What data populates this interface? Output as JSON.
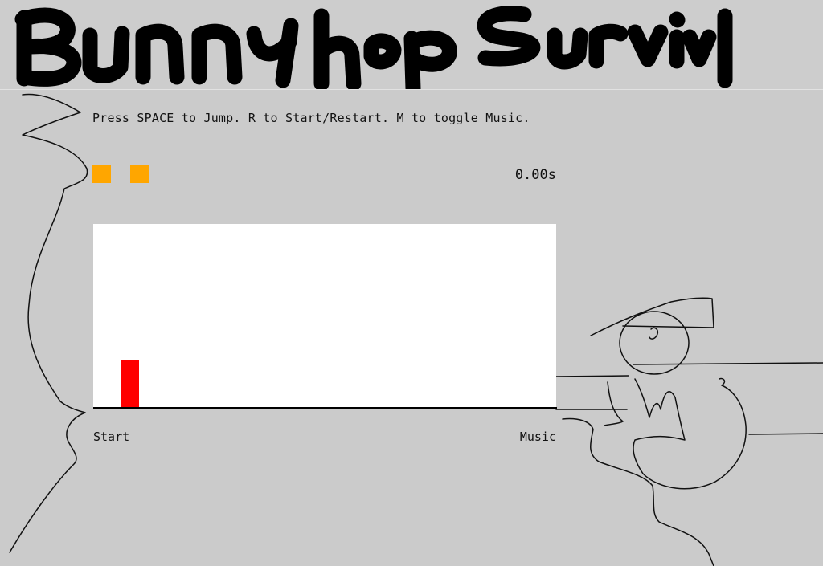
{
  "game": {
    "title_image_text": "Bunny hop Survival",
    "instructions": "Press SPACE to Jump. R to Start/Restart. M to toggle Music.",
    "lives": 2,
    "timer": "0.00s",
    "start_label": "Start",
    "music_label": "Music"
  },
  "colors": {
    "background": "#cbcbcb",
    "play_area": "#ffffff",
    "player": "#ff0000",
    "life_marker": "#ffa600",
    "ground": "#000000"
  }
}
